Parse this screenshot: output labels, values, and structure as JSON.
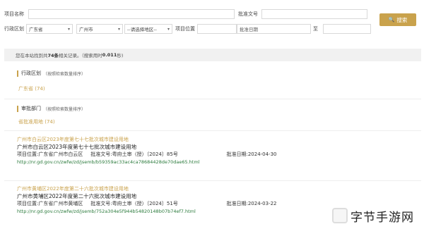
{
  "form": {
    "project_name_label": "项目名称",
    "project_name_value": "",
    "approval_no_label": "批准文号",
    "approval_no_value": "",
    "region_label": "行政区划",
    "province": "广东省",
    "city": "广州市",
    "district_placeholder": "--请选择地区--",
    "location_label": "项目位置",
    "location_value": "",
    "approval_date_label": "批准日期",
    "to_label": "至",
    "search_label": "搜索",
    "search_icon": "search-icon"
  },
  "summary": {
    "prefix": "您在本站找到共",
    "count": "74条",
    "middle": "相关记录。（搜索用时",
    "time": "0.011",
    "suffix": "秒)"
  },
  "facets": [
    {
      "title": "行政区划",
      "hint": "（按照检索数量排序）",
      "link": "广东省 (74)"
    },
    {
      "title": "审批部门",
      "hint": "（按照检索数量排序）",
      "link": "省批准用地 (74)"
    }
  ],
  "results": [
    {
      "title": "广州市白云区2023年度第七十七批次城市建设用地",
      "subtitle": "广州市白云区2023年度第七十七批次城市建设用地",
      "location": "项目位置:广东省广州市白云区",
      "approval_no": "批准文号:粤府土审（授）〔2024〕85号",
      "approval_date": "批准日期:2024-04-30",
      "url": "http://nr.gd.gov.cn/zwfw/zd/jsemb/b59359ac33ac4ca78684428de70dae65.html"
    },
    {
      "title": "广州市黄埔区2022年度第二十六批次城市建设用地",
      "subtitle": "广州市黄埔区2022年度第二十六批次城市建设用地",
      "location": "项目位置:广东省广州市黄埔区",
      "approval_no": "批准文号:粤府土审（授）〔2024〕51号",
      "approval_date": "批准日期:2024-03-22",
      "url": "http://nr.gd.gov.cn/zwfw/zd/jsemb/752a304e5f944b54820148b07b74ef7.html"
    }
  ],
  "watermark": {
    "text": "字节手游网"
  }
}
